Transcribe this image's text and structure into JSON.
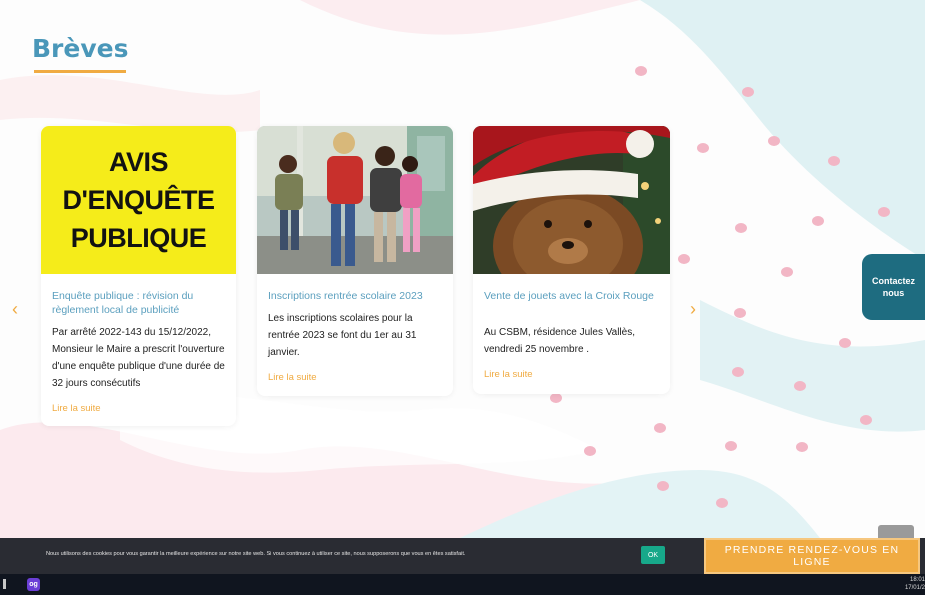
{
  "section": {
    "title": "Brèves"
  },
  "cards": [
    {
      "image_lines": [
        "AVIS",
        "D'ENQUÊTE",
        "PUBLIQUE"
      ],
      "title": "Enquête publique : révision du règlement local de publicité",
      "text": "Par arrêté 2022-143 du 15/12/2022, Monsieur le Maire a prescrit l'ouverture d'une enquête publique d'une durée de 32 jours consécutifs",
      "link": "Lire la suite"
    },
    {
      "title": "Inscriptions rentrée scolaire 2023",
      "text": "Les inscriptions scolaires pour la rentrée 2023 se font du 1er au 31 janvier.",
      "link": "Lire la suite"
    },
    {
      "title": "Vente de jouets avec la Croix Rouge",
      "text": "Au CSBM, résidence Jules Vallès, vendredi 25 novembre .",
      "link": "Lire la suite"
    }
  ],
  "carousel": {
    "prev_icon": "chevron-left-icon",
    "next_icon": "chevron-right-icon",
    "prev": "‹",
    "next": "›"
  },
  "contact_tab": {
    "line1": "Contactez",
    "line2": "nous"
  },
  "cookie_bar": {
    "text": "Nous utilisons des cookies pour vous garantir la meilleure expérience sur notre site web. Si vous continuez à utiliser ce site, nous supposerons que vous en êtes satisfait.",
    "ok_label": "OK"
  },
  "cta": {
    "label": "PRENDRE RENDEZ-VOUS EN LIGNE"
  },
  "taskbar": {
    "app_label": "og",
    "time": "18:01",
    "date": "17/01/2"
  },
  "colors": {
    "title": "#4a97b9",
    "accent": "#f0ab42",
    "contact_tab": "#1e6c80",
    "cookie_bar": "#2a2c33",
    "ok_button": "#17a88a",
    "avis_yellow": "#f5ec1a"
  }
}
